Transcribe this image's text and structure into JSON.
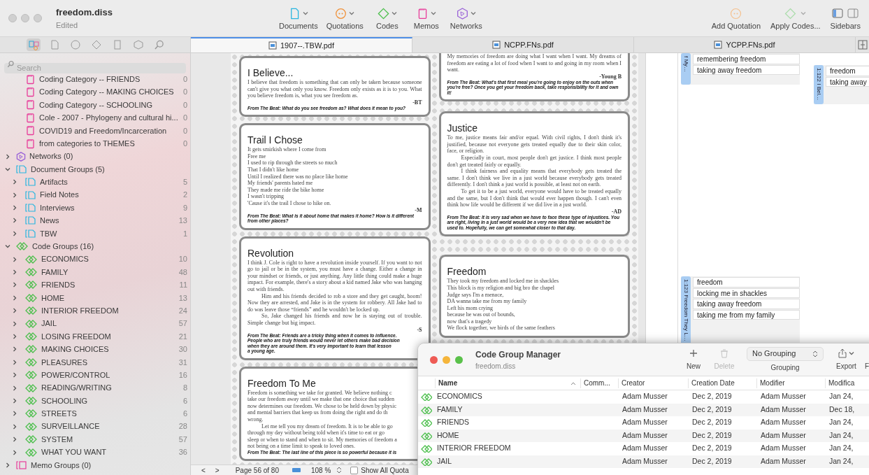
{
  "window": {
    "title": "freedom.diss",
    "subtitle": "Edited"
  },
  "toolbar": {
    "center": [
      {
        "kind": "documents",
        "label": "Documents"
      },
      {
        "kind": "quotations",
        "label": "Quotations"
      },
      {
        "kind": "codes",
        "label": "Codes"
      },
      {
        "kind": "memos",
        "label": "Memos"
      },
      {
        "kind": "networks",
        "label": "Networks"
      }
    ],
    "right": [
      {
        "kind": "add-quotation",
        "label": "Add Quotation"
      },
      {
        "kind": "apply-codes",
        "label": "Apply Codes..."
      },
      {
        "kind": "sidebars",
        "label": "Sidebars"
      }
    ]
  },
  "sidebar_tools": [
    {
      "kind": "project",
      "selected": true
    },
    {
      "kind": "documents",
      "selected": false
    },
    {
      "kind": "quotations",
      "selected": false
    },
    {
      "kind": "codes",
      "selected": false
    },
    {
      "kind": "memos",
      "selected": false
    },
    {
      "kind": "networks",
      "selected": false
    },
    {
      "kind": "search",
      "selected": false
    }
  ],
  "tabs": [
    {
      "label": "1907--.TBW.pdf",
      "selected": true
    },
    {
      "label": "NCPP.FNs.pdf",
      "selected": false
    },
    {
      "label": "YCPP.FNs.pdf",
      "selected": false
    }
  ],
  "sidebar": {
    "search": {
      "placeholder": "Search"
    },
    "memo_items": [
      {
        "label": "Coding Category -- FRIENDS",
        "count": "0"
      },
      {
        "label": "Coding Category -- MAKING CHOICES",
        "count": "0"
      },
      {
        "label": "Coding Category -- SCHOOLING",
        "count": "0"
      },
      {
        "label": "Cole - 2007 - Phylogeny and cultural hi...",
        "count": "0"
      },
      {
        "label": "COVID19 and Freedom/Incarceration",
        "count": "0"
      },
      {
        "label": "from categories to THEMES",
        "count": "0"
      }
    ],
    "groups": [
      {
        "kind": "network",
        "label": "Networks (0)",
        "expanded": false
      },
      {
        "kind": "docgroup",
        "label": "Document Groups (5)",
        "expanded": true,
        "children": [
          {
            "label": "Artifacts",
            "count": "5",
            "expanded": false
          },
          {
            "label": "Field Notes",
            "count": "2",
            "expanded": false
          },
          {
            "label": "Interviews",
            "count": "9",
            "expanded": false
          },
          {
            "label": "News",
            "count": "13",
            "expanded": false
          },
          {
            "label": "TBW",
            "count": "1",
            "expanded": false
          }
        ]
      },
      {
        "kind": "codegroup",
        "label": "Code Groups (16)",
        "expanded": true,
        "children": [
          {
            "label": "ECONOMICS",
            "count": "10",
            "expanded": false
          },
          {
            "label": "FAMILY",
            "count": "48",
            "expanded": false
          },
          {
            "label": "FRIENDS",
            "count": "11",
            "expanded": false
          },
          {
            "label": "HOME",
            "count": "13",
            "expanded": false
          },
          {
            "label": "INTERIOR FREEDOM",
            "count": "24",
            "expanded": false
          },
          {
            "label": "JAIL",
            "count": "57",
            "expanded": false
          },
          {
            "label": "LOSING FREEDOM",
            "count": "21",
            "expanded": false
          },
          {
            "label": "MAKING CHOICES",
            "count": "30",
            "expanded": false
          },
          {
            "label": "PLEASURES",
            "count": "31",
            "expanded": false
          },
          {
            "label": "POWER/CONTROL",
            "count": "16",
            "expanded": false
          },
          {
            "label": "READING/WRITING",
            "count": "8",
            "expanded": false
          },
          {
            "label": "SCHOOLING",
            "count": "6",
            "expanded": false
          },
          {
            "label": "STREETS",
            "count": "6",
            "expanded": false
          },
          {
            "label": "SURVEILLANCE",
            "count": "28",
            "expanded": false
          },
          {
            "label": "SYSTEM",
            "count": "57",
            "expanded": false
          },
          {
            "label": "WHAT YOU WANT",
            "count": "36",
            "expanded": false
          }
        ]
      },
      {
        "kind": "memogroup",
        "label": "Memo Groups (0)",
        "expanded": false
      }
    ]
  },
  "document": {
    "left": [
      {
        "kind": "prose",
        "title": "I Believe...",
        "paragraphs": [
          "I believe that freedom is something that can only be taken because someone can't give you what only you know. Freedom only exists as it is to you. What you believe freedom is, what you see freedom as."
        ],
        "signature": "-BT",
        "prompt": [
          "From The Beat: What do you see freedom as? What does it mean to you?"
        ]
      },
      {
        "kind": "poem",
        "title": "Trail I Chose",
        "paragraphs": [
          "It gets smirkish where I come from",
          "Free me",
          "I used to rip through the streets so much",
          "That I didn't like home",
          "Until I realized there was no place like home",
          "My friends' parents hated me",
          "They made me ride the bike home",
          "I wasn't tripping",
          "'Cause it's the trail I chose to hike on."
        ],
        "signature": "-M",
        "prompt": [
          "From The Beat: What is it about home that makes it home? How is it different from other places?"
        ]
      },
      {
        "kind": "prose",
        "title": "Revolution",
        "paragraphs": [
          "I think J. Cole is right to have a revolution inside yourself. If you want to not go to jail or be in the system, you must have a change. Either a change in your mindset or friends, or just anything. Any little thing could make a huge impact. For example, there's a story about a kid named Jake who was hanging out with friends.",
          "Him and his friends decided to rob a store and they get caught, boom! Now they are arrested, and Jake is in the system for robbery. All Jake had to do was leave those “friends” and he wouldn't be locked up.",
          "So, Jake changed his friends and now he is staying out of trouble. Simple change but big impact."
        ],
        "signature": "-S",
        "prompt": [
          "From The Beat: Friends are a tricky thing when it comes to influence.",
          "People who are truly friends would never let others make bad decision",
          "when they are around them. It's very important to learn that lesson",
          "a young age."
        ]
      },
      {
        "kind": "lines",
        "title": "Freedom To Me",
        "paragraphs": [
          "Freedom is something we take for granted. We believe nothing c",
          "take our freedom away until we make that one choice that sudden",
          "now determines our freedom. We chose to be held down by physic",
          "and mental barriers that keep us from doing the right and do th",
          "wrong.",
          "Let me tell you my dream of freedom. It is to be able to go",
          "through my day without being told when it's time to eat or go",
          "sleep or when to stand and when to sit. My memories of freedom a",
          "not being on a time limit to speak to loved ones."
        ],
        "prompt": [
          "From The Beat: The last line of this piece is so powerful because it is"
        ]
      }
    ],
    "right": [
      {
        "kind": "prose",
        "paragraphs": [
          "My memories of freedom are doing what I want when I want. My dreams of freedom are eating a lot of food when I want to and going in my room when I want."
        ],
        "signature": "-Young B",
        "prompt": [
          "From The Beat: What's that first meal you're going to enjoy on the outs when you're free? Once you get your freedom back, take responsibility for it and own it!"
        ]
      },
      {
        "kind": "prose",
        "title": "Justice",
        "paragraphs": [
          "To me, justice means fair and/or equal. With civil rights, I don't think it's justified, because not everyone gets treated equally due to their skin color, face, or religion.",
          "Especially in court, most people don't get justice. I think most people don't get treated fairly or equally.",
          "I think fairness and equality means that everybody gets treated the same. I don't think we live in a just world because everybody gets treated differently. I don't think a just world is possible, at least not on earth.",
          "To get it to be a just world, everyone would have to be treated equally and the same, but I don't think that would ever happen though. I can't even think how life would be different if we did live in a just world."
        ],
        "signature": "-AD",
        "prompt": [
          "From The Beat: It is very sad when we have to face these type of injustices. You are right, living in a just world would be a very new idea that we wouldn't be used to. Hopefully, we can get somewhat closer to that day."
        ]
      },
      {
        "kind": "poem",
        "title": "Freedom",
        "paragraphs": [
          "They took my freedom and locked me in shackles",
          "This block is my religion and big bro the chapel",
          "Judge says I'm a menace,",
          "DA wanna take me from my family",
          "Left his mom crying",
          "because he was out of bounds,",
          "now that's a tragedy",
          "We flock together, we birds of the same feathers"
        ]
      }
    ],
    "status": {
      "prev": "<",
      "next": ">",
      "page": "Page 56 of 80",
      "zoom": "108 %",
      "show_all": "Show All Quota",
      "show_all_checked": false
    }
  },
  "margin": {
    "quotations": [
      {
        "label": "f My…",
        "codes": [
          "remembering freedom",
          "taking away freedom"
        ]
      },
      {
        "label": "1:122 I Bel…",
        "codes": [
          "freedom",
          "taking away"
        ]
      },
      {
        "label": "1:123 Freedom They L…",
        "codes": [
          "freedom",
          "locking me in shackles",
          "taking away freedom",
          "taking me from my family"
        ]
      }
    ]
  },
  "manager": {
    "title": "Code Group Manager",
    "subtitle": "freedom.diss",
    "actions": [
      {
        "kind": "new",
        "label": "New",
        "disabled": false
      },
      {
        "kind": "delete",
        "label": "Delete",
        "disabled": true
      }
    ],
    "grouping": {
      "value": "No Grouping",
      "label": "Grouping"
    },
    "export": {
      "label": "Export"
    },
    "cut_label": "F",
    "columns": [
      {
        "label": "Name",
        "sorted": true
      },
      {
        "label": "Comm...",
        "sorted": false
      },
      {
        "label": "Creator",
        "sorted": false
      },
      {
        "label": "Creation Date",
        "sorted": false
      },
      {
        "label": "Modifier",
        "sorted": false
      },
      {
        "label": "Modifica",
        "sorted": false
      }
    ],
    "rows": [
      {
        "name": "ECONOMICS",
        "creator": "Adam Musser",
        "created": "Dec 2, 2019",
        "modifier": "Adam Musser",
        "modified": "Jan 24,"
      },
      {
        "name": "FAMILY",
        "creator": "Adam Musser",
        "created": "Dec 2, 2019",
        "modifier": "Adam Musser",
        "modified": "Dec 18,"
      },
      {
        "name": "FRIENDS",
        "creator": "Adam Musser",
        "created": "Dec 2, 2019",
        "modifier": "Adam Musser",
        "modified": "Jan 24,"
      },
      {
        "name": "HOME",
        "creator": "Adam Musser",
        "created": "Dec 2, 2019",
        "modifier": "Adam Musser",
        "modified": "Jan 24,"
      },
      {
        "name": "INTERIOR FREEDOM",
        "creator": "Adam Musser",
        "created": "Dec 2, 2019",
        "modifier": "Adam Musser",
        "modified": "Jan 24,"
      },
      {
        "name": "JAIL",
        "creator": "Adam Musser",
        "created": "Dec 2, 2019",
        "modifier": "Adam Musser",
        "modified": "Jan 24,"
      }
    ]
  }
}
